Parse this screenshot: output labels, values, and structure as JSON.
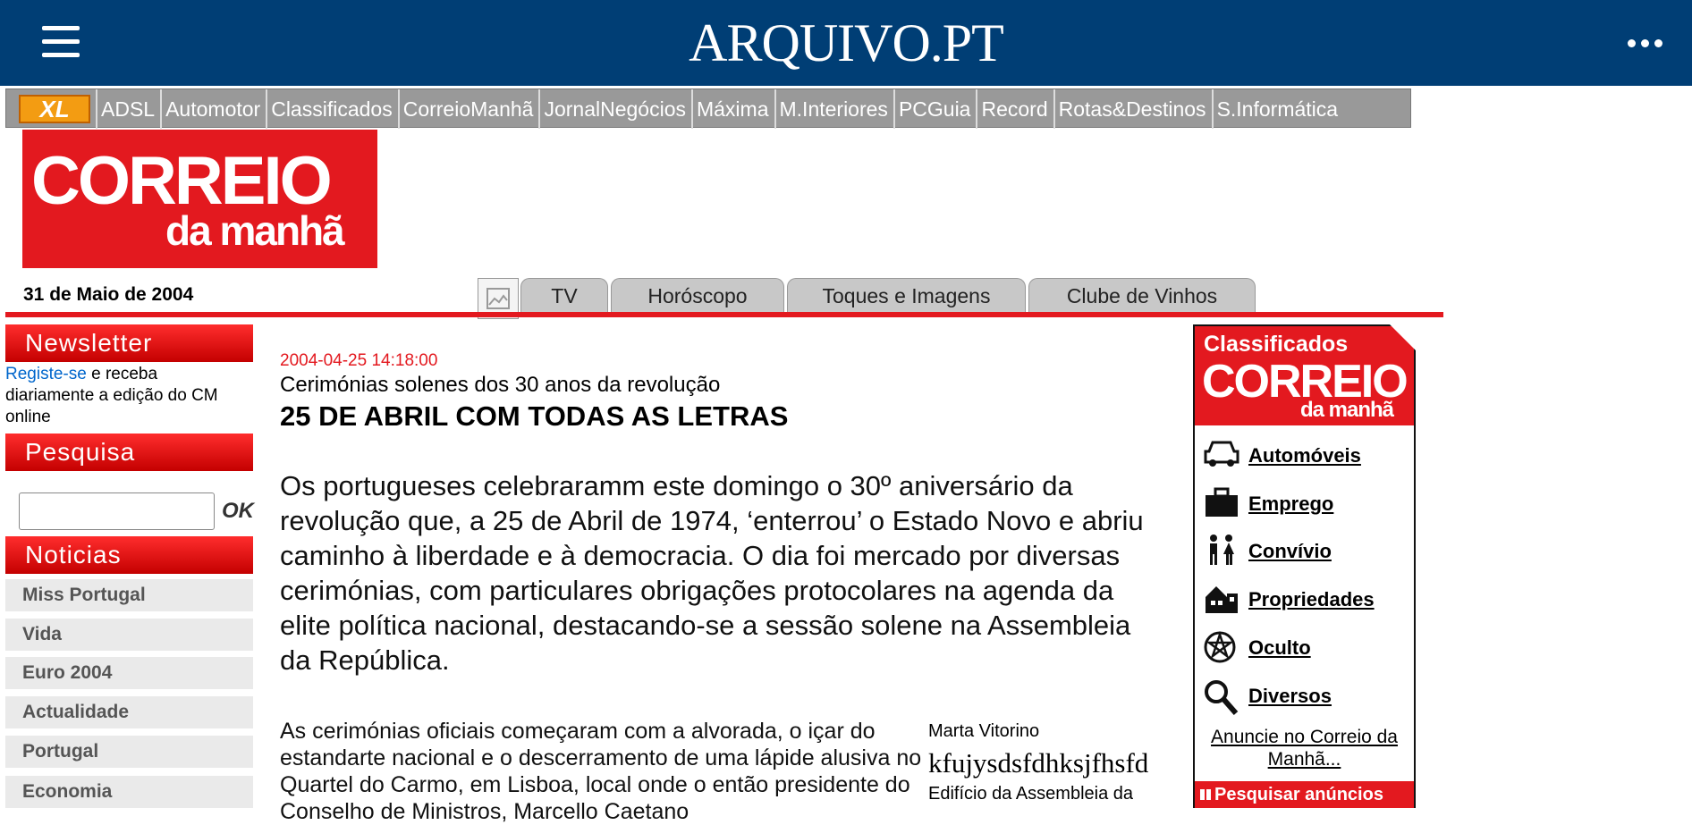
{
  "archive": {
    "brand": "ARQUIVO.PT"
  },
  "sites": {
    "logo": "XL",
    "items": [
      "ADSL",
      "Automotor",
      "Classificados",
      "CorreioManhã",
      "JornalNegócios",
      "Máxima",
      "M.Interiores",
      "PCGuia",
      "Record",
      "Rotas&Destinos",
      "S.Informática"
    ]
  },
  "logo": {
    "line1": "CORREIO",
    "line2": "da manhã"
  },
  "date": "31 de Maio de 2004",
  "tabs": [
    "TV",
    "Horóscopo",
    "Toques e Imagens",
    "Clube de Vinhos"
  ],
  "sidebar": {
    "newsletter_title": "Newsletter",
    "newsletter_link": "Registe-se",
    "newsletter_text": " e receba diariamente a edição do CM online",
    "search_title": "Pesquisa",
    "search_button": "OK",
    "news_title": "Noticias",
    "news_items": [
      "Miss Portugal",
      "Vida",
      "Euro 2004",
      "Actualidade",
      "Portugal",
      "Economia"
    ]
  },
  "article": {
    "timestamp": "2004-04-25 14:18:00",
    "subtitle": "Cerimónias solenes dos 30 anos da revolução",
    "headline": "25 DE ABRIL COM TODAS AS LETRAS",
    "lead": "Os portugueses celebraramm este domingo o 30º aniversário da revolução que, a 25 de Abril de 1974, ‘enterrou’ o Estado Novo e abriu caminho à liberdade e à democracia. O dia foi mercado por diversas cerimónias, com particulares obrigações protocolares na agenda da elite política nacional, destacando-se a sessão solene na Assembleia da República.",
    "body": "As cerimónias oficiais começaram com a alvorada, o içar do estandarte nacional e o descerramento de uma lápide alusiva no Quartel do Carmo, em Lisboa, local onde o então presidente do Conselho de Ministros, Marcello Caetano",
    "caption_author": "Marta Vitorino",
    "caption_image_text": "kfujysdsfdhksjfhsfd",
    "caption_text": "Edifício da Assembleia da"
  },
  "classifieds": {
    "head1": "Classificados",
    "head2": "CORREIO",
    "head3": "da manhã",
    "items": [
      {
        "label": "Automóveis",
        "icon": "car-icon"
      },
      {
        "label": "Emprego",
        "icon": "briefcase-icon"
      },
      {
        "label": "Convívio",
        "icon": "people-icon"
      },
      {
        "label": "Propriedades",
        "icon": "house-icon"
      },
      {
        "label": "Oculto",
        "icon": "pentagram-icon"
      },
      {
        "label": "Diversos",
        "icon": "magnifier-icon"
      }
    ],
    "announce": "Anuncie no Correio da Manhã...",
    "search_ads": "Pesquisar anúncios"
  }
}
